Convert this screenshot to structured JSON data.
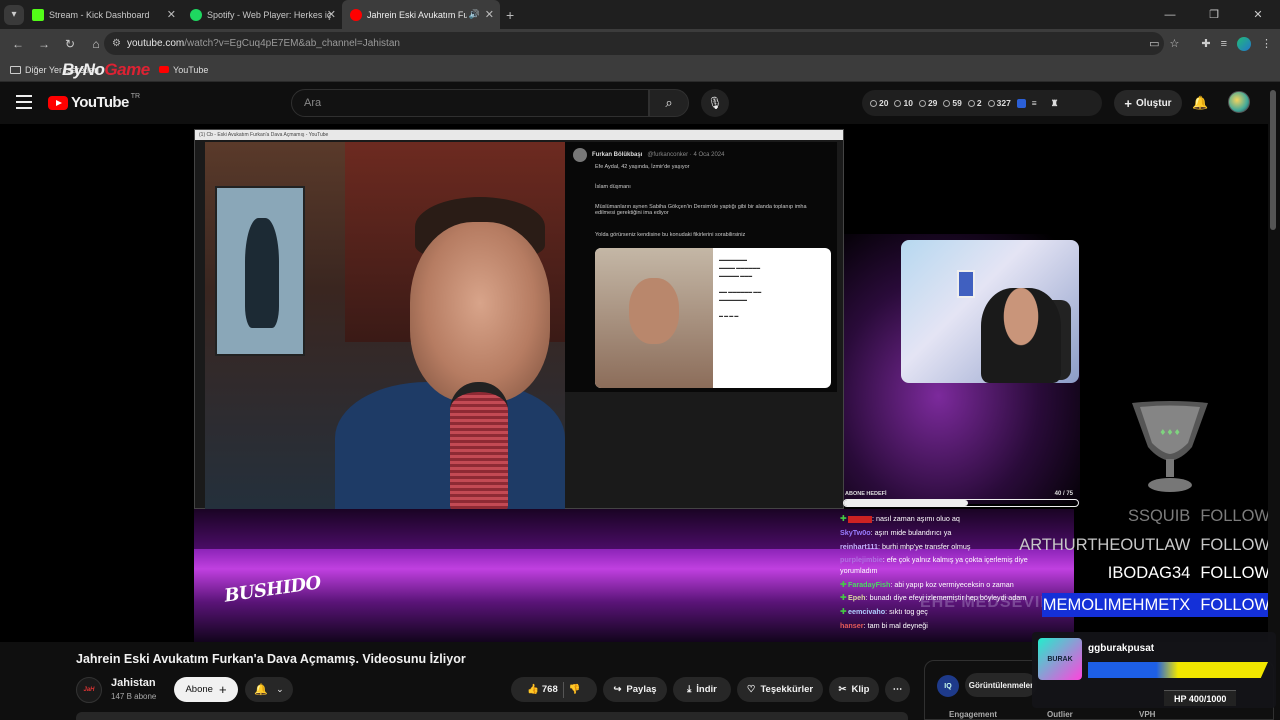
{
  "browser": {
    "tabs": [
      {
        "label": "Stream - Kick Dashboard",
        "color": "#53fc18"
      },
      {
        "label": "Spotify - Web Player: Herkes iç",
        "color": "#1ed760"
      },
      {
        "label": "Jahrein Eski Avukatım Furka",
        "color": "#ff0000"
      }
    ],
    "url_host": "youtube.com",
    "url_path": "/watch?v=EgCuq4pE7EM&ab_channel=Jahistan",
    "bookmarks": [
      "Diğer Yer İşaretleri",
      "YouTube"
    ],
    "overlay_logo_a": "ByNo",
    "overlay_logo_b": "Game"
  },
  "youtube": {
    "logo_text": "YouTube",
    "region": "TR",
    "search_placeholder": "Ara",
    "stats": [
      "20",
      "10",
      "29",
      "59",
      "2",
      "327"
    ],
    "create_label": "Oluştur"
  },
  "stream": {
    "inner_title": "(1) Cb - Eski Avukatım Furkan'a Dava Açmamış - YouTube",
    "tweet_author": "Furkan Bölükbaşı",
    "tweet_handle": "@furkanconker · 4 Oca 2024",
    "tweet_lines": [
      "Efe Aydal, 42 yaşında, İzmir'de yaşıyor",
      "İslam düşmanı",
      "Müslümanların aynen Sabiha Gökçen'in Dersim'de yaptığı gibi bir alanda toplanıp imha edilmesi gerektiğini ima ediyor",
      "Yolda görürseniz kendisine bu konudaki fikirlerini sorabilirsiniz"
    ],
    "banner_brand": "BUSHIDO",
    "watermark": "EHE MEDSEVIN",
    "sub_goal_label": "ABONE HEDEFİ",
    "sub_goal_count": "40 / 75",
    "sub_goal_fraction": 0.53,
    "chat": [
      {
        "user": "",
        "msg": ": nasıl zaman aşımı oluo aq",
        "color": "#e33",
        "badge": true
      },
      {
        "user": "SkyTw0o",
        "msg": ": aşırı mide bulandırıcı ya",
        "color": "#9a7cff",
        "badge": false
      },
      {
        "user": "reinhart111",
        "msg": ": burhi mhp'ye transfer olmuş",
        "color": "#c7b3ff",
        "badge": false
      },
      {
        "user": "purplejimbie",
        "msg": ": efe çok yalnız kalmış ya çokta içerlemiş diye yorumladım",
        "color": "#b070e0",
        "badge": false
      },
      {
        "user": "FaradayFish",
        "msg": ": abi yapıp koz vermiyeceksin o zaman",
        "color": "#4cd964",
        "badge": true
      },
      {
        "user": "Epeh",
        "msg": ": bunadı diye efeyi izlememiştir hep böyleydi adam",
        "color": "#d9d9a0",
        "badge": true
      },
      {
        "user": "eemcivaho",
        "msg": ": sıktı tog geç",
        "color": "#b0d0ff",
        "badge": true
      },
      {
        "user": "hanser",
        "msg": ": tam bi mal deyneği",
        "color": "#e45a5a",
        "badge": false
      }
    ],
    "followers": [
      {
        "name": "SSQUIB",
        "action": "FOLLOW"
      },
      {
        "name": "ARTHURTHEOUTLAW",
        "action": "FOLLOW"
      },
      {
        "name": "IBODAG34",
        "action": "FOLLOW"
      },
      {
        "name": "MEMOLIMEHMETX",
        "action": "FOLLOW"
      }
    ],
    "streamer_card": {
      "name": "ggburakpusat",
      "hp": "HP 400/1000",
      "logo": "BURAK"
    }
  },
  "video": {
    "title": "Jahrein Eski Avukatım Furkan'a Dava Açmamış. Videosunu İzliyor",
    "channel": "Jahistan",
    "channel_logo": "JaH",
    "subscribers": "147 B abone",
    "subscribe_label": "Abone",
    "likes": "768",
    "share_label": "Paylaş",
    "download_label": "İndir",
    "thanks_label": "Teşekkürler",
    "clip_label": "Klip"
  },
  "analytics": {
    "iq": "IQ",
    "views_label": "Görüntülenmeler",
    "columns": [
      "Engagement",
      "Outlier",
      "VPH"
    ]
  }
}
